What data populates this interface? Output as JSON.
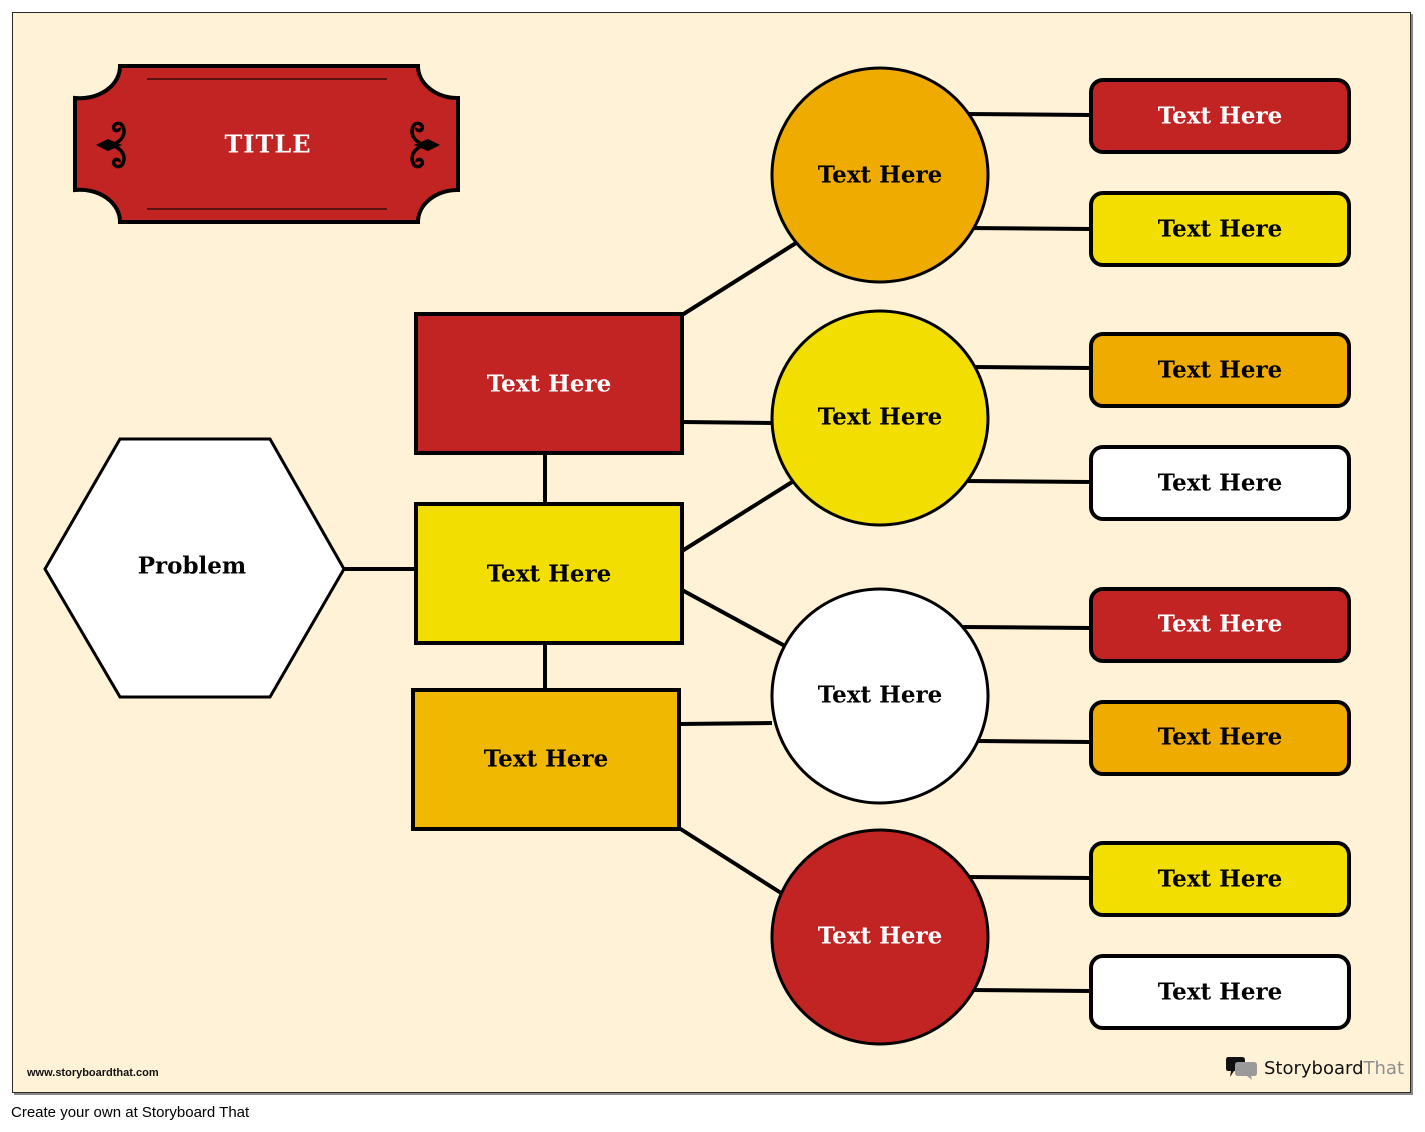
{
  "title": "TITLE",
  "problem": {
    "label": "Problem",
    "fill": "#ffffff",
    "text_color": "#000000"
  },
  "causes": [
    {
      "label": "Text Here",
      "fill": "#c22323",
      "text_color": "#ffffff"
    },
    {
      "label": "Text Here",
      "fill": "#f2de00",
      "text_color": "#000000"
    },
    {
      "label": "Text Here",
      "fill": "#f0b800",
      "text_color": "#000000"
    }
  ],
  "circles": [
    {
      "label": "Text Here",
      "fill": "#f0ab00",
      "text_color": "#000000",
      "details": [
        {
          "label": "Text Here",
          "fill": "#c22323",
          "text_color": "#ffffff"
        },
        {
          "label": "Text Here",
          "fill": "#f2de00",
          "text_color": "#000000"
        }
      ]
    },
    {
      "label": "Text Here",
      "fill": "#f2de00",
      "text_color": "#000000",
      "details": [
        {
          "label": "Text Here",
          "fill": "#f0ab00",
          "text_color": "#000000"
        },
        {
          "label": "Text Here",
          "fill": "#ffffff",
          "text_color": "#000000"
        }
      ]
    },
    {
      "label": "Text Here",
      "fill": "#ffffff",
      "text_color": "#000000",
      "details": [
        {
          "label": "Text Here",
          "fill": "#c22323",
          "text_color": "#ffffff"
        },
        {
          "label": "Text Here",
          "fill": "#f0ab00",
          "text_color": "#000000"
        }
      ]
    },
    {
      "label": "Text Here",
      "fill": "#c22323",
      "text_color": "#ffffff",
      "details": [
        {
          "label": "Text Here",
          "fill": "#f2de00",
          "text_color": "#000000"
        },
        {
          "label": "Text Here",
          "fill": "#ffffff",
          "text_color": "#000000"
        }
      ]
    }
  ],
  "colors": {
    "background": "#fff2d6",
    "title_banner": "#c22323",
    "outline": "#000000"
  },
  "watermark_url": "www.storyboardthat.com",
  "brand": {
    "part1": "Storyboard",
    "part2": "That",
    "icon": "speech-bubbles-icon"
  },
  "footer_text": "Create your own at Storyboard That"
}
